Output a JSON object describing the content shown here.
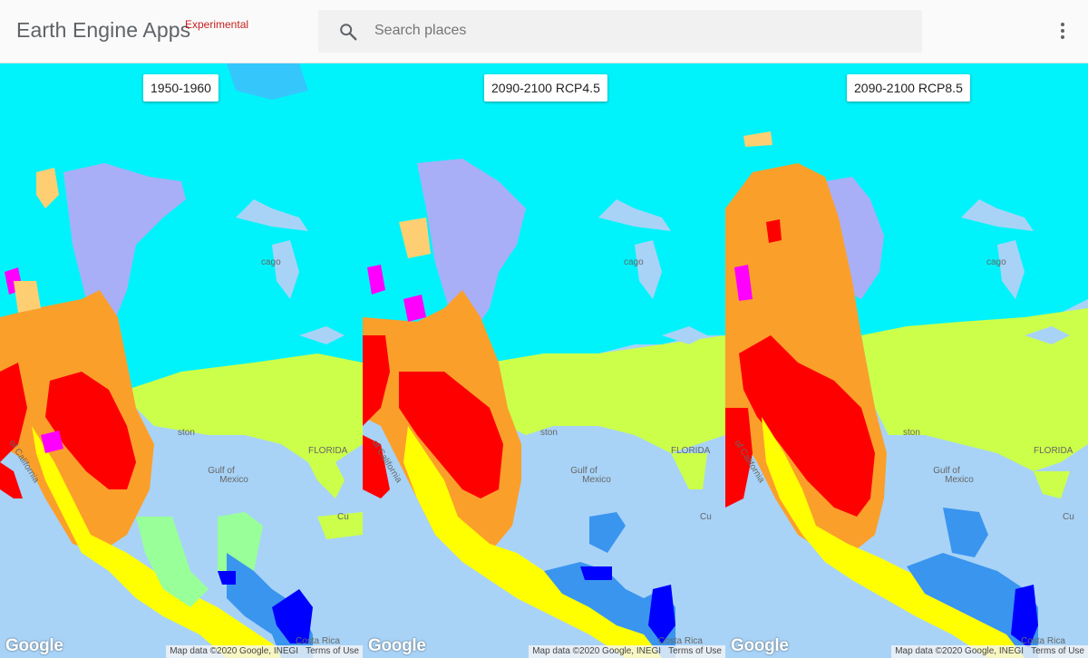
{
  "app": {
    "title": "Earth Engine Apps",
    "tag": "Experimental"
  },
  "search": {
    "placeholder": "Search places",
    "value": ""
  },
  "icons": {
    "search": "search-icon",
    "menu": "more-vert-icon"
  },
  "panels": [
    {
      "label": "1950-1960",
      "map_data": "Map data ©2020 Google, INEGI",
      "terms": "Terms of Use",
      "logo": "Google"
    },
    {
      "label": "2090-2100 RCP4.5",
      "map_data": "Map data ©2020 Google, INEGI",
      "terms": "Terms of Use",
      "logo": "Google"
    },
    {
      "label": "2090-2100 RCP8.5",
      "map_data": "Map data ©2020 Google, INEGI",
      "terms": "Terms of Use",
      "logo": "Google"
    }
  ],
  "map_labels": {
    "gulf": "Gulf of Mexico",
    "gulf_line1": "Gulf of",
    "gulf_line2": "Mexico",
    "houston": "ston",
    "florida": "FLORIDA",
    "california": "of California",
    "cuba": "Cu",
    "costa_rica": "Costa Rica",
    "chicago": "cago"
  },
  "colors": {
    "water": "#a8d3f7",
    "cold": "#00f3fb",
    "subarctic": "#35c7fb",
    "lavender": "#a8aff7",
    "temperate": "#ccff4a",
    "arid_orange": "#fb9f2b",
    "hot_red": "#ff0000",
    "yellow": "#ffff00",
    "magenta": "#ff00ff",
    "tan": "#fdcf72",
    "tropical_blue": "#3a95ef",
    "deep_blue": "#0000ff",
    "light_green": "#99ff99",
    "brand_text": "#5f6368",
    "tag_red": "#c5221f"
  }
}
